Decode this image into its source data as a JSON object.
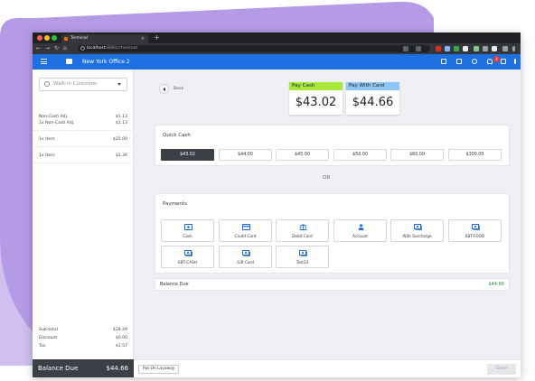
{
  "browser": {
    "tab_title": "Terminal",
    "tab_close": "×",
    "new_tab": "+",
    "url_host": "localhost",
    "url_path": ":8081/checkout"
  },
  "header": {
    "store_name": "New York Office 2",
    "cart_count": "4"
  },
  "customer": {
    "placeholder": "Walk-in Customer"
  },
  "order": {
    "groups": [
      {
        "rows": [
          {
            "label": "Non-Cash Adj.",
            "value": "$1.13"
          },
          {
            "label": "1x Non-Cash Adj.",
            "value": "$1.13"
          }
        ]
      },
      {
        "rows": [
          {
            "label": "1x Item",
            "value": "$25.00"
          }
        ]
      },
      {
        "rows": [
          {
            "label": "1x Item",
            "value": "$2.36"
          }
        ]
      }
    ],
    "subtotal_label": "Sub-total",
    "subtotal_value": "$28.49",
    "discount_label": "Discount",
    "discount_value": "$0.00",
    "tax_label": "Tax",
    "tax_value": "$1.57",
    "balance_label": "Balance Due",
    "balance_value": "$44.66"
  },
  "main": {
    "back_label": "Back",
    "pay_cash_label": "Pay Cash",
    "pay_cash_amount": "$43.02",
    "pay_card_label": "Pay With Card",
    "pay_card_amount": "$44.66",
    "quick_cash_title": "Quick Cash",
    "quick_cash": [
      "$43.02",
      "$44.00",
      "$45.00",
      "$50.00",
      "$60.00",
      "$100.00"
    ],
    "or_label": "OR",
    "payments_title": "Payments",
    "payments": [
      {
        "label": "Cash",
        "icon": "cash-icon"
      },
      {
        "label": "Credit Card",
        "icon": "credit-card-icon"
      },
      {
        "label": "Debit Card",
        "icon": "bank-icon"
      },
      {
        "label": "Account",
        "icon": "person-icon"
      },
      {
        "label": "With Surcharge",
        "icon": "money-icon"
      },
      {
        "label": "EBT-FOOD",
        "icon": "money-icon"
      },
      {
        "label": "EBT-CASH",
        "icon": "money-icon"
      },
      {
        "label": "Gift Card",
        "icon": "money-icon"
      },
      {
        "label": "Test23",
        "icon": "money-icon"
      }
    ],
    "balance_due_label": "Balance Due",
    "balance_due_value": "$44.66"
  },
  "footer": {
    "layaway_label": "Put On Layaway",
    "done_label": "Done"
  },
  "colors": {
    "app_blue": "#1e6fe0",
    "pay_cash_green": "#a7e83a",
    "pay_card_blue": "#8ec5f5",
    "icon_blue": "#1e6fe0",
    "dark_panel": "#3b3f46",
    "balance_green": "#2e8b3d",
    "backdrop_purple": "#b59ae6"
  }
}
